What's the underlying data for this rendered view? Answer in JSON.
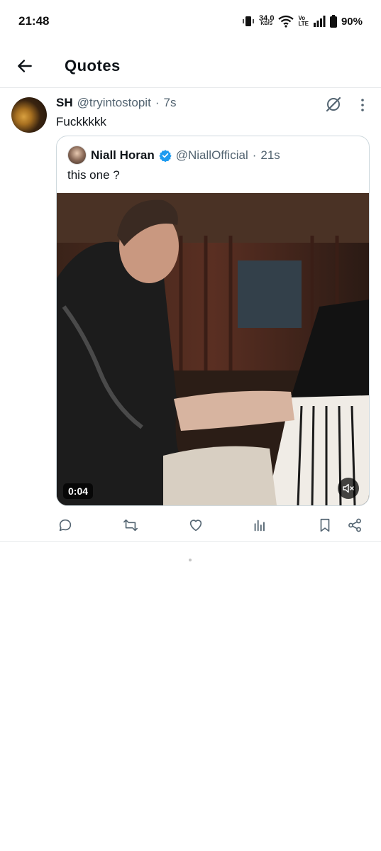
{
  "status_bar": {
    "time": "21:48",
    "speed_value": "34.0",
    "speed_unit": "KB/S",
    "volte_top": "Vo",
    "volte_bottom": "LTE",
    "battery": "90%"
  },
  "header": {
    "title": "Quotes"
  },
  "tweet": {
    "name": "SH",
    "handle": "@tryintostopit",
    "dot": "·",
    "time": "7s",
    "text": "Fuckkkkk",
    "quote": {
      "name": "Niall Horan",
      "handle": "@NiallOfficial",
      "dot": "·",
      "time": "21s",
      "text": "this one ?",
      "video_duration": "0:04"
    }
  },
  "colors": {
    "text": "#0f1419",
    "secondary": "#536471",
    "verified": "#1d9bf0",
    "border": "#cfd9de"
  }
}
